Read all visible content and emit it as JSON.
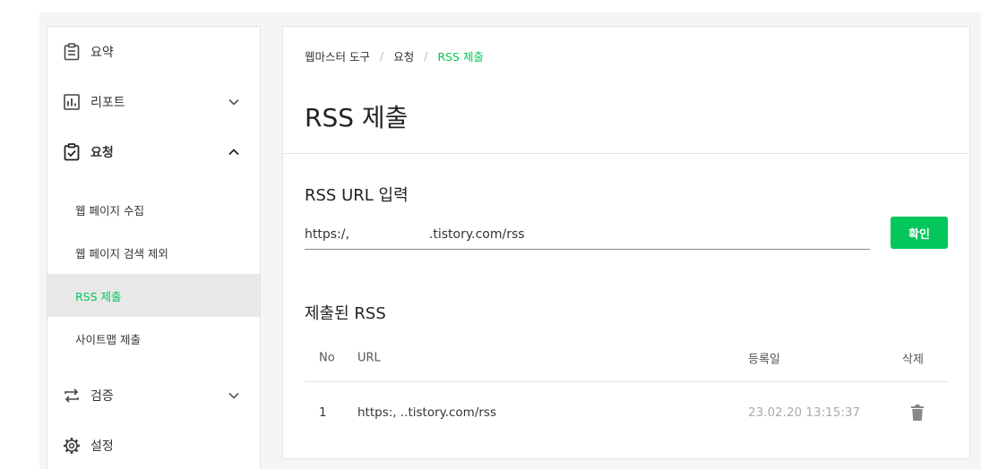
{
  "sidebar": {
    "items": [
      {
        "label": "요약",
        "icon": "clipboard-icon"
      },
      {
        "label": "리포트",
        "icon": "bar-chart-icon"
      },
      {
        "label": "요청",
        "icon": "clipboard-check-icon"
      },
      {
        "label": "검증",
        "icon": "repeat-icon"
      },
      {
        "label": "설정",
        "icon": "gear-icon"
      }
    ],
    "subitems": [
      {
        "label": "웹 페이지 수집"
      },
      {
        "label": "웹 페이지 검색 제외"
      },
      {
        "label": "RSS 제출"
      },
      {
        "label": "사이트맵 제출"
      }
    ]
  },
  "breadcrumb": [
    "웹마스터 도구",
    "요청",
    "RSS 제출"
  ],
  "page_title": "RSS 제출",
  "rss_input": {
    "title": "RSS URL 입력",
    "value": "https:/,                    .tistory.com/rss",
    "button": "확인"
  },
  "submitted": {
    "title": "제출된 RSS",
    "columns": {
      "no": "No",
      "url": "URL",
      "date": "등록일",
      "delete": "삭제"
    },
    "rows": [
      {
        "no": "1",
        "url": "https:,                 ..tistory.com/rss",
        "date": "23.02.20 13:15:37"
      }
    ]
  },
  "colors": {
    "accent": "#03c75a"
  }
}
